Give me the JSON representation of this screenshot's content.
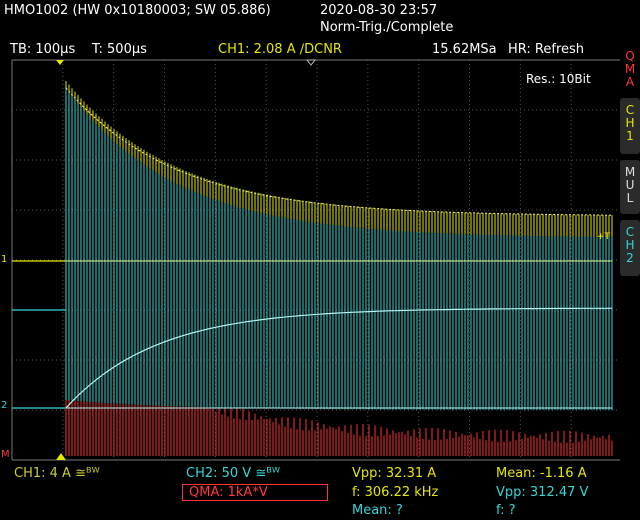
{
  "header": {
    "device": "HMO1002 (HW 0x10180003; SW 05.886)",
    "datetime": "2020-08-30 23:57",
    "trigger_status": "Norm-Trig./Complete"
  },
  "settings_bar": {
    "timebase": "TB: 100µs",
    "trigger_time": "T: 500µs",
    "ch1_trigger": "CH1: 2.08 A ∕DCNR",
    "sample_rate": "15.62MSa",
    "hr_mode": "HR: Refresh"
  },
  "display": {
    "resolution": "Res.: 10Bit",
    "trigger_marker": "+T",
    "ch1_marker": "1",
    "ch2_marker": "2",
    "m_marker": "M"
  },
  "side_menu": [
    {
      "label": "Q\nM\nA",
      "color": "#ff3333"
    },
    {
      "label": "C\nH\n1",
      "color": "#e6e600"
    },
    {
      "label": "M\nU\nL",
      "color": "#dddddd"
    },
    {
      "label": "C\nH\n2",
      "color": "#33d6d6"
    }
  ],
  "footer": {
    "ch1_scale": "CH1: 4 A ≅ᴮᵂ",
    "ch2_scale": "CH2: 50 V ≅ᴮᵂ",
    "qma_scale": "QMA: 1kA*V",
    "meas_vpp1": "Vpp: 32.31 A",
    "meas_freq": "f: 306.22 kHz",
    "meas_mean1": "Mean: ?",
    "meas_mean2": "Mean: -1.16 A",
    "meas_vpp2": "Vpp: 312.47 V",
    "meas_f2": "f: ?"
  },
  "colors": {
    "ch1": "#e6e600",
    "ch2": "#33d6d6",
    "math": "#ff3333",
    "grid": "#555555"
  }
}
